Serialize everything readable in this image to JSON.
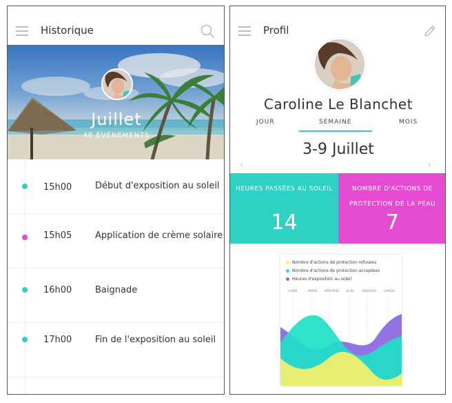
{
  "screen_history": {
    "header": {
      "title": "Historique",
      "menu_icon": "hamburger-icon",
      "search_icon": "search-icon"
    },
    "hero": {
      "month": "Juillet",
      "events": "48 ÉVÈNEMENTS"
    },
    "timeline": [
      {
        "time": "15h00",
        "label": "Début d'exposition au soleil",
        "color": "#2ed1c4"
      },
      {
        "time": "15h05",
        "label": "Application de crème solaire",
        "color": "#e54bd1"
      },
      {
        "time": "16h00",
        "label": "Baignade",
        "color": "#2ed1c4"
      },
      {
        "time": "17h00",
        "label": "Fin de l'exposition au soleil",
        "color": "#2ed1c4"
      }
    ]
  },
  "screen_profile": {
    "header": {
      "title": "Profil",
      "menu_icon": "hamburger-icon",
      "edit_icon": "pencil-icon"
    },
    "name": "Caroline Le Blanchet",
    "tabs": [
      {
        "label": "JOUR",
        "active": false
      },
      {
        "label": "SEMAINE",
        "active": true
      },
      {
        "label": "MOIS",
        "active": false
      }
    ],
    "range": "3-9 Juillet",
    "prev_icon": "chevron-left-icon",
    "next_icon": "chevron-right-icon",
    "stats": [
      {
        "label": "HEURES PASSÉES AU SOLEIL",
        "value": "14",
        "color": "#2ed1c4"
      },
      {
        "label": "NOMBRE D'ACTIONS DE PROTECTION DE LA PEAU",
        "value": "7",
        "color": "#e54bd1"
      }
    ],
    "chart": {
      "legend": [
        {
          "label": "Nombre d'actions de protection refusées",
          "color": "#f5ef6b"
        },
        {
          "label": "Nombre d'actions de protection acceptées",
          "color": "#1fe0c8"
        },
        {
          "label": "Heures d'exposition au soleil",
          "color": "#8d6ce0"
        }
      ],
      "days": [
        "LUNDI",
        "MARDI",
        "MERCREDI",
        "JEUDI",
        "VENDREDI",
        "SAMEDI"
      ]
    }
  }
}
